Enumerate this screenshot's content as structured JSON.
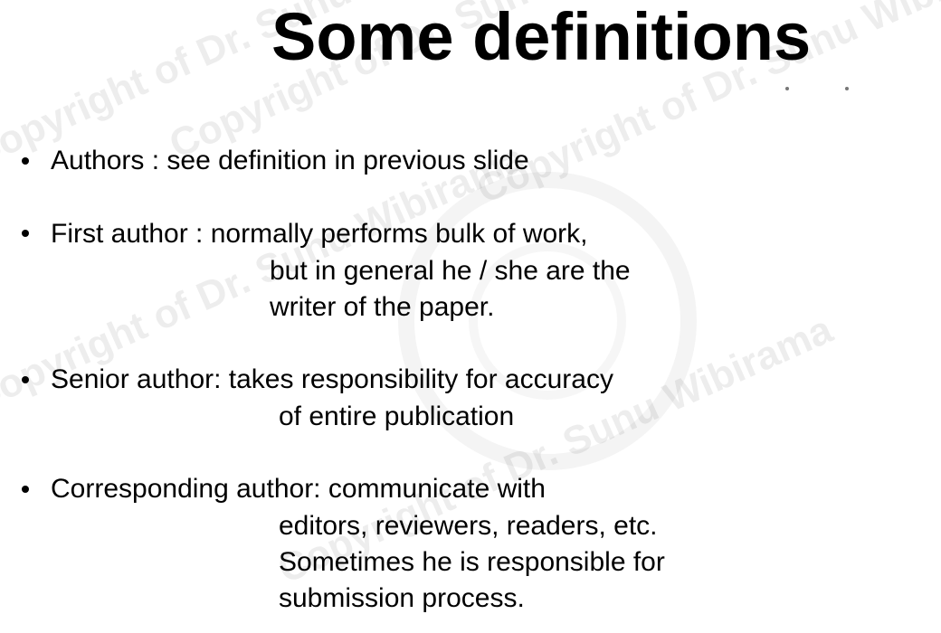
{
  "slide": {
    "title": "Some definitions",
    "items": [
      {
        "lines": [
          "Authors : see definition in previous slide"
        ]
      },
      {
        "lines": [
          "First author : normally performs bulk of work,",
          "but in general he / she are the",
          "writer of the paper."
        ]
      },
      {
        "lines": [
          "Senior author: takes responsibility for accuracy",
          "of entire publication"
        ]
      },
      {
        "lines": [
          "Corresponding author: communicate with",
          "editors, reviewers, readers, etc.",
          "Sometimes he is responsible for",
          "submission process."
        ]
      }
    ]
  },
  "watermark": {
    "texts": [
      "Copyright of Dr. Sunu Wibirama",
      "Copyright of Dr. Sunu Wibirama",
      "Copyright of Dr. Sunu Wibirama",
      "Copyright of Dr. Sunu Wibirama",
      "Copyright of Dr. Sunu Wibirama"
    ]
  }
}
